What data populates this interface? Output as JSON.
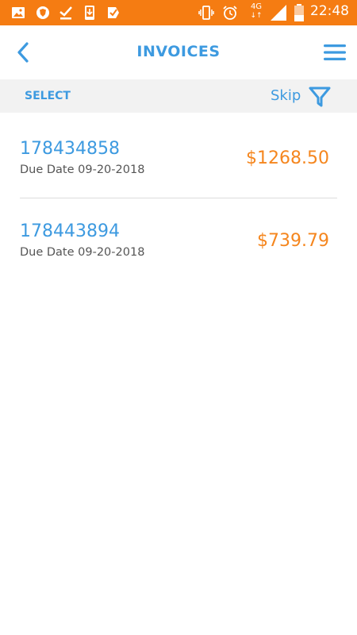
{
  "status_bar": {
    "time": "22:48",
    "left_icons": [
      "image-icon",
      "shield-icon",
      "check-download-icon",
      "phone-download-icon",
      "ticket-check-icon"
    ],
    "right_icons": [
      "vibrate-icon",
      "alarm-icon",
      "network-4g-icon",
      "signal-icon",
      "battery-icon"
    ],
    "network_label": "4G",
    "color": "#f57c12"
  },
  "header": {
    "title": "INVOICES"
  },
  "toolbar": {
    "select_label": "SELECT",
    "skip_label": "Skip"
  },
  "invoices": [
    {
      "number": "178434858",
      "due": "Due Date 09-20-2018",
      "amount": "$1268.50"
    },
    {
      "number": "178443894",
      "due": "Due Date 09-20-2018",
      "amount": "$739.79"
    }
  ],
  "colors": {
    "accent": "#3d9ae0",
    "amount": "#f5861e",
    "toolbar_bg": "#f2f2f2"
  }
}
